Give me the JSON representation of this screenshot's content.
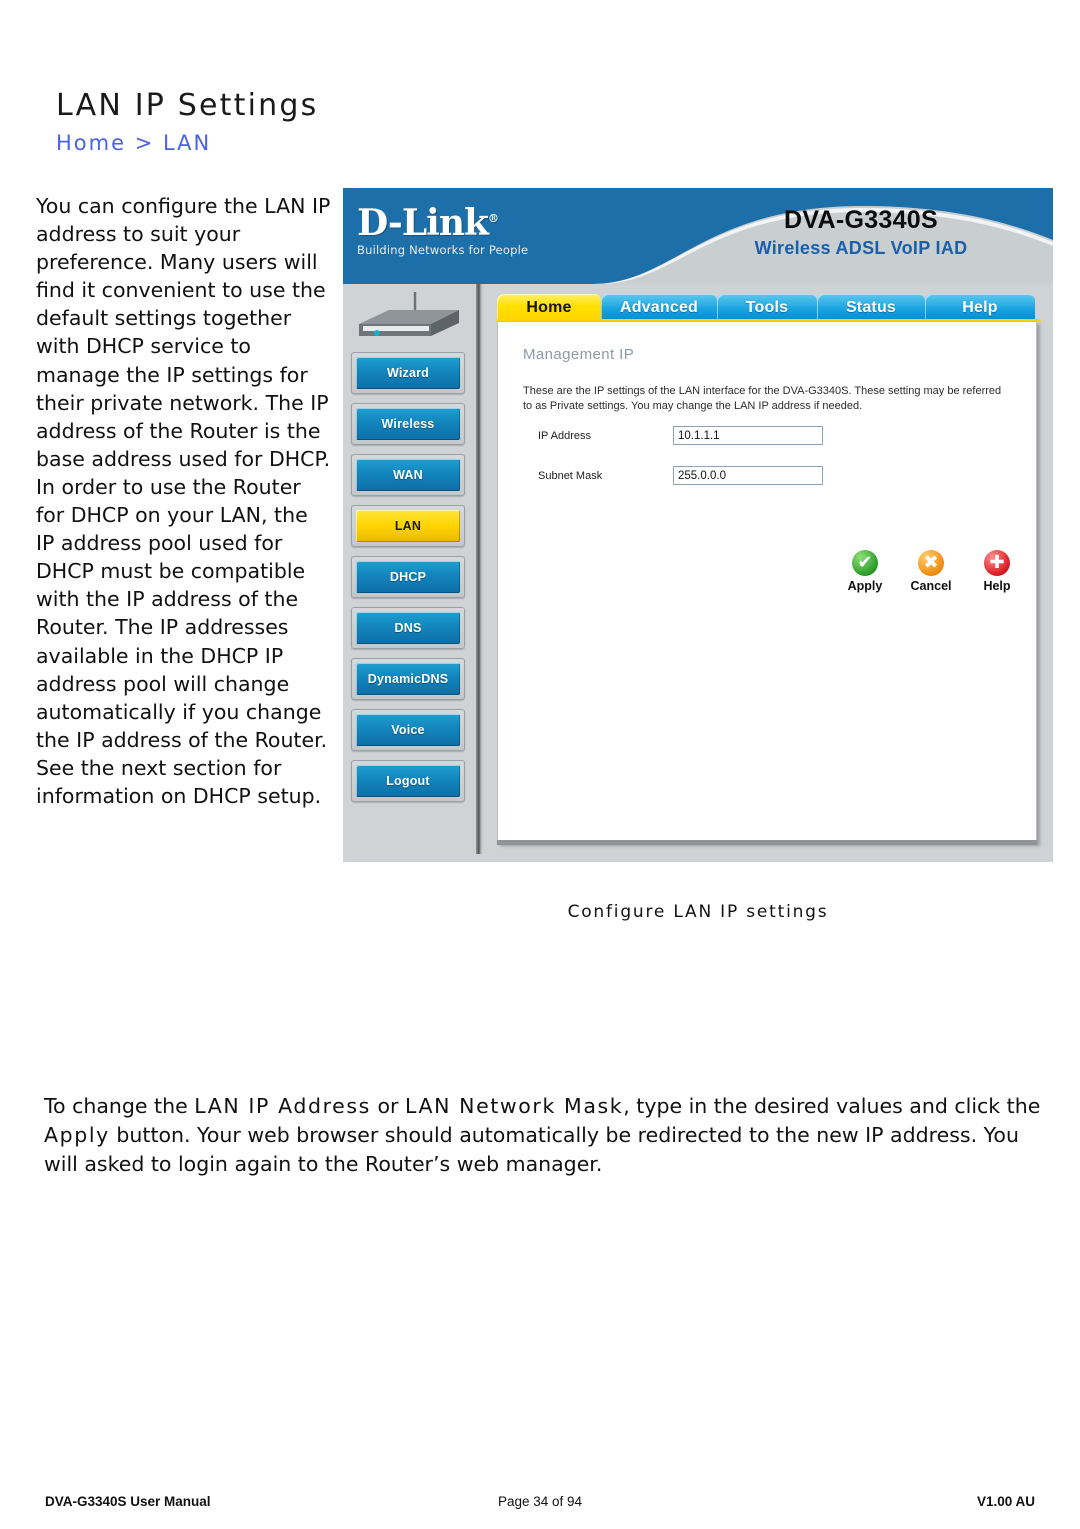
{
  "page": {
    "title": "LAN IP Settings",
    "breadcrumb": "Home > LAN",
    "left_text": "You can configure the LAN IP address to suit your preference. Many users will find it convenient to use the default settings together with DHCP service to manage the IP settings for their private network. The IP address of the Router is the base address used for DHCP. In order to use the Router for DHCP on your LAN, the IP address pool used for DHCP must be compatible with the IP address of the Router. The IP addresses available in the DHCP IP address pool will change automatically if you change the IP address of the Router. See the next section for information on DHCP setup.",
    "figure_caption": "Configure LAN IP settings",
    "bottom_paragraph": {
      "part1": "To change the ",
      "em1": "LAN IP Address",
      "part2": " or ",
      "em2": "LAN Network Mask",
      "part3": ", type in the desired values and click the ",
      "em3": "Apply",
      "part4": " button.   Your web browser should automatically be redirected to the new IP address. You will asked to login again to the Router’s web manager."
    }
  },
  "router_ui": {
    "brand": {
      "logo_text": "D-Link",
      "registered_mark": "®",
      "tagline": "Building Networks for People",
      "model": "DVA-G3340S",
      "model_subtitle": "Wireless ADSL VoIP IAD"
    },
    "tabs": [
      {
        "label": "Home",
        "active": true
      },
      {
        "label": "Advanced",
        "active": false
      },
      {
        "label": "Tools",
        "active": false
      },
      {
        "label": "Status",
        "active": false
      },
      {
        "label": "Help",
        "active": false
      }
    ],
    "sidebar": [
      {
        "label": "Wizard",
        "active": false
      },
      {
        "label": "Wireless",
        "active": false
      },
      {
        "label": "WAN",
        "active": false
      },
      {
        "label": "LAN",
        "active": true
      },
      {
        "label": "DHCP",
        "active": false
      },
      {
        "label": "DNS",
        "active": false
      },
      {
        "label": "DynamicDNS",
        "active": false
      },
      {
        "label": "Voice",
        "active": false
      },
      {
        "label": "Logout",
        "active": false
      }
    ],
    "panel": {
      "heading": "Management IP",
      "description": "These are the IP settings of the LAN interface for the DVA-G3340S. These setting may be referred to as Private settings. You may change the LAN IP address if needed.",
      "fields": [
        {
          "label": "IP Address",
          "value": "10.1.1.1"
        },
        {
          "label": "Subnet Mask",
          "value": "255.0.0.0"
        }
      ],
      "actions": [
        {
          "label": "Apply",
          "icon": "check-circle-icon",
          "glyph": "✔"
        },
        {
          "label": "Cancel",
          "icon": "cross-circle-icon",
          "glyph": "✖"
        },
        {
          "label": "Help",
          "icon": "plus-circle-icon",
          "glyph": "✚"
        }
      ]
    },
    "colors": {
      "banner_blue": "#1c6fa8",
      "tab_active_yellow": "#ffd400",
      "tab_blue": "#19a4e0",
      "apply_green": "#2a9c26",
      "cancel_orange": "#ef8a10",
      "help_red": "#d81b20"
    }
  },
  "footer": {
    "left": "DVA-G3340S User Manual",
    "center": "Page 34 of 94",
    "right": "V1.00 AU"
  }
}
